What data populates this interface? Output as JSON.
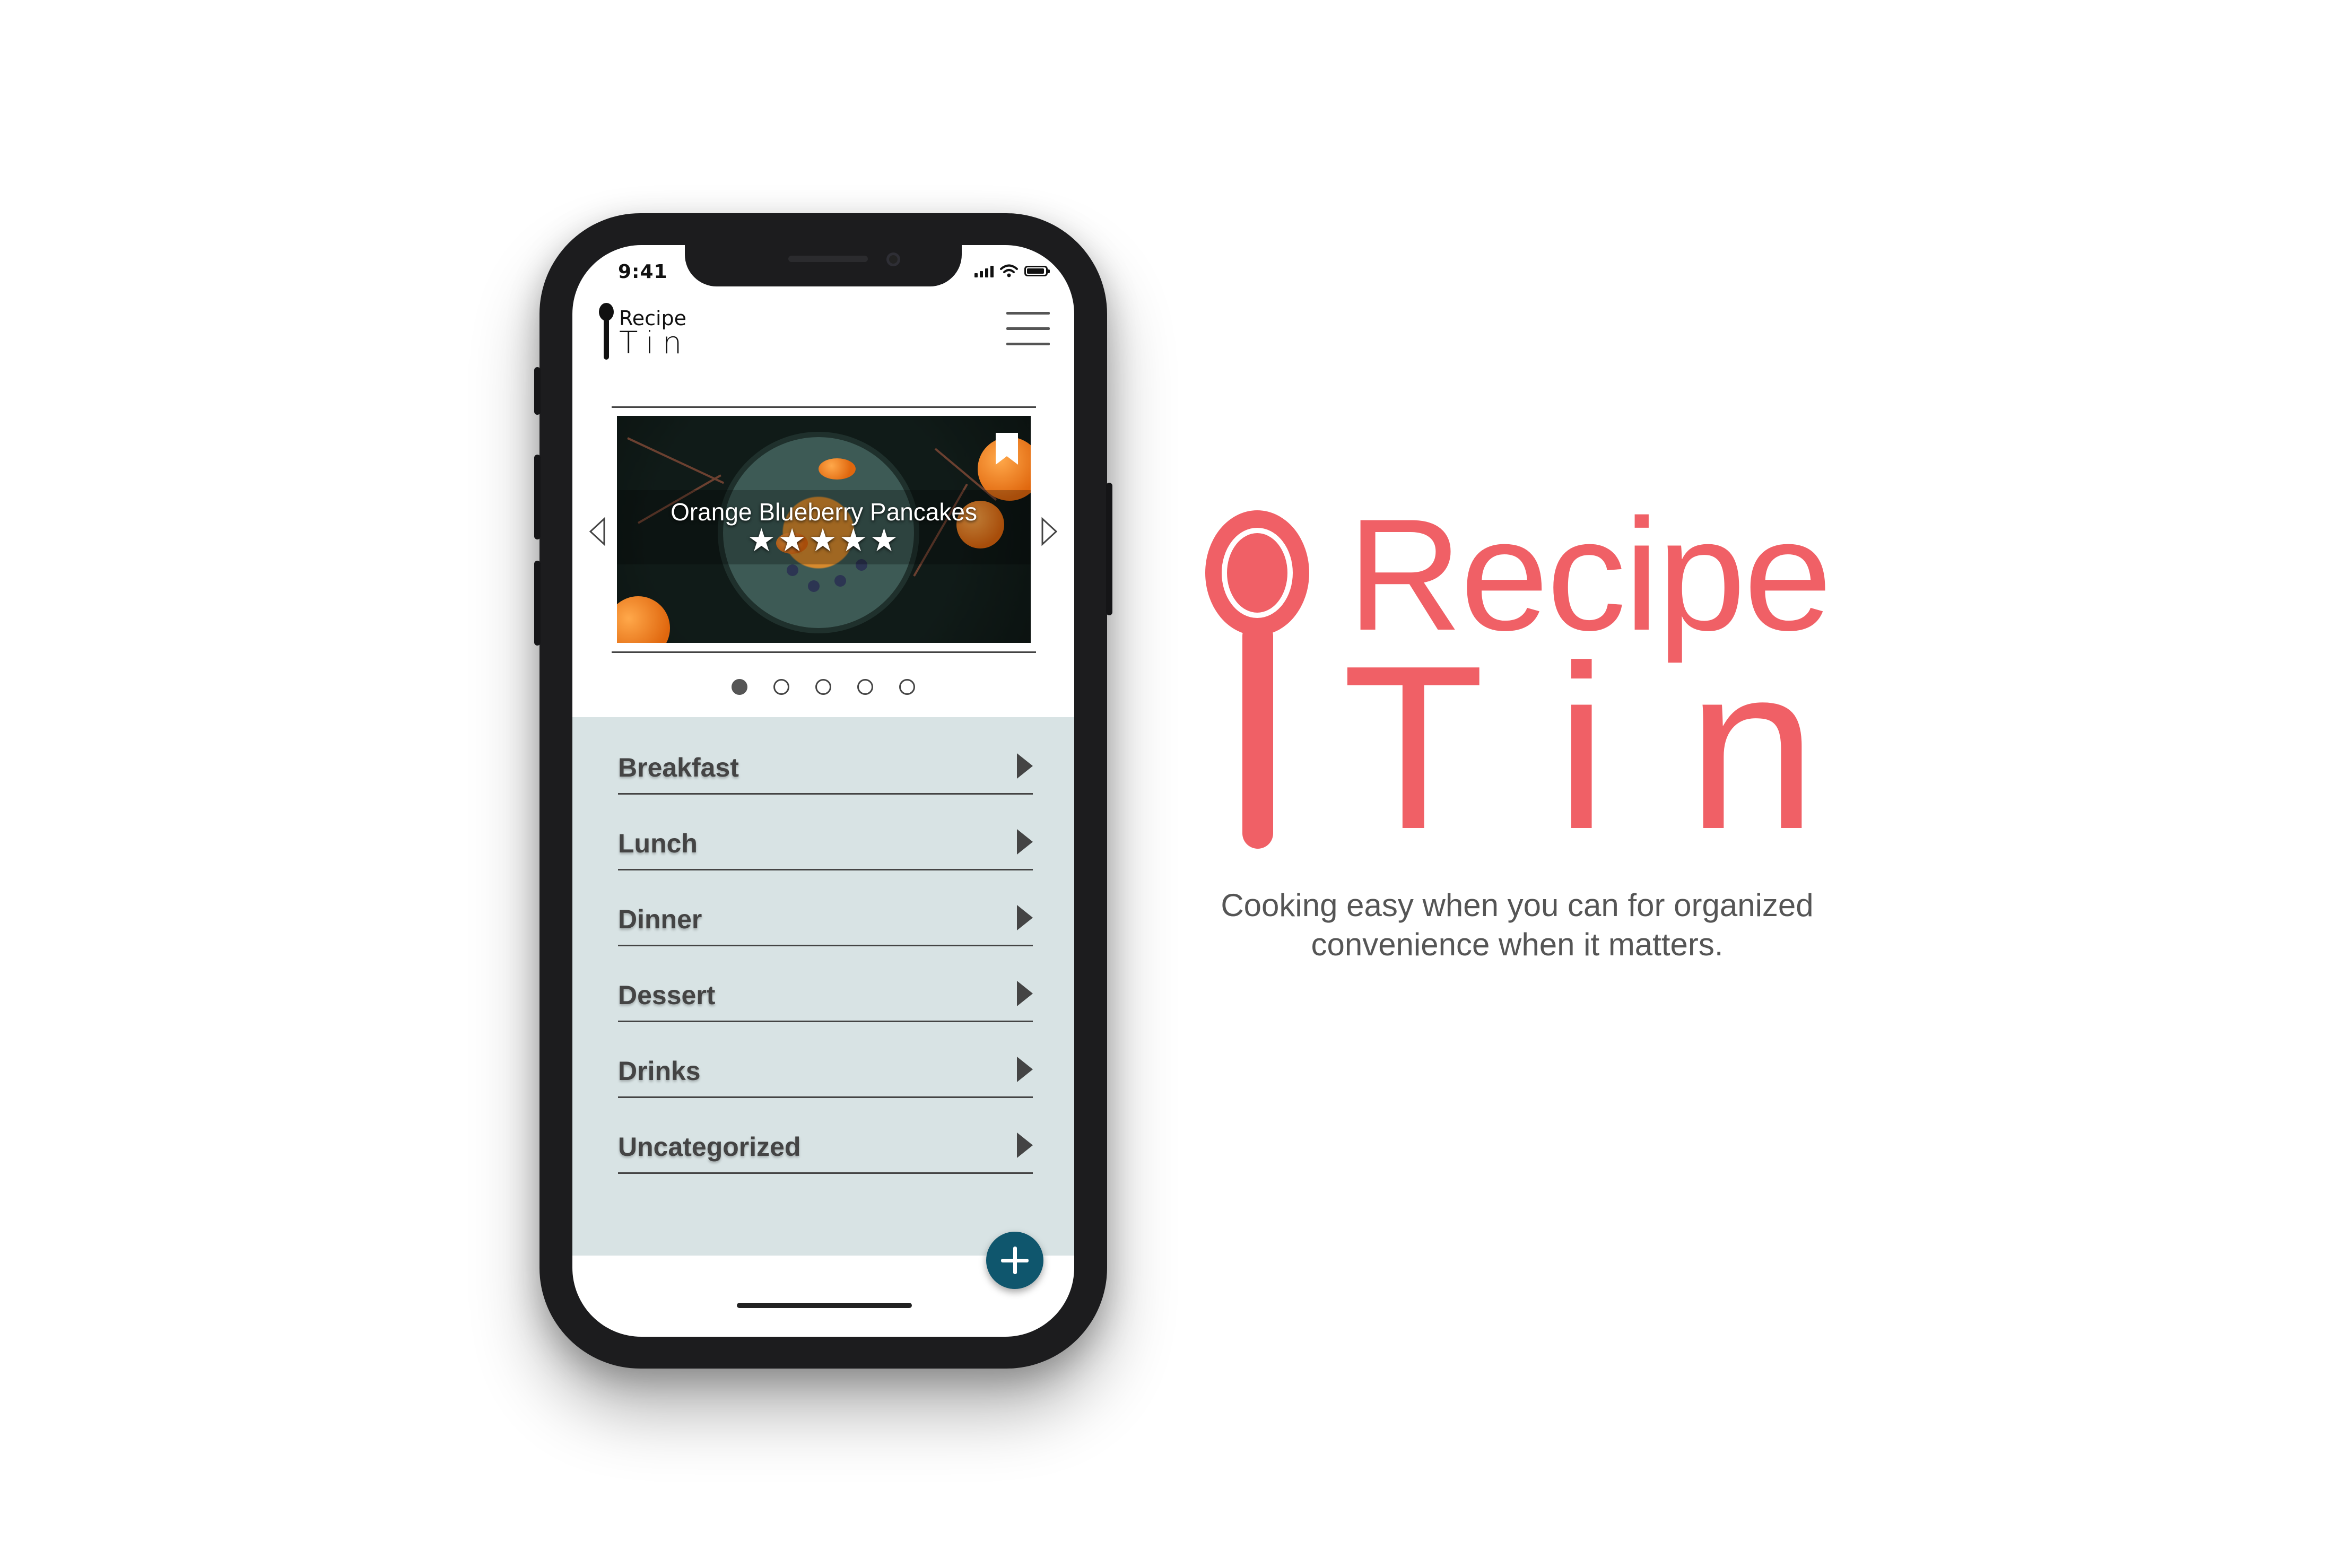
{
  "status_bar": {
    "time": "9:41"
  },
  "app_header": {
    "logo_top": "Recipe",
    "logo_bottom": "Tin"
  },
  "featured": {
    "title": "Orange Blueberry Pancakes",
    "rating": 5,
    "rating_max": 5,
    "stars_text": "★★★★★"
  },
  "carousel": {
    "slide_count": 5,
    "active_index": 0
  },
  "categories": [
    {
      "label": "Breakfast"
    },
    {
      "label": "Lunch"
    },
    {
      "label": "Dinner"
    },
    {
      "label": "Dessert"
    },
    {
      "label": "Drinks"
    },
    {
      "label": "Uncategorized"
    }
  ],
  "brand": {
    "name_top": "Recipe",
    "name_bottom": "Tin",
    "tagline": "Cooking easy when you can for organized convenience when it matters.",
    "color": "#f06066"
  },
  "colors": {
    "panel_bg": "#d8e3e4",
    "accent_button": "#0f566d"
  }
}
